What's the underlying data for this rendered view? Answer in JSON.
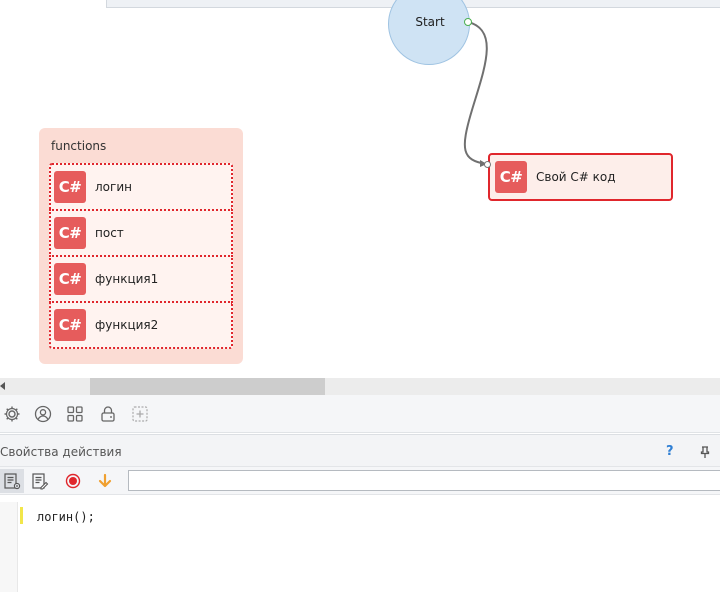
{
  "canvas": {
    "start_node": {
      "label": "Start"
    },
    "action_node": {
      "badge": "C#",
      "label": "Свой C# код"
    },
    "functions_group": {
      "title": "functions",
      "items": [
        {
          "badge": "C#",
          "label": "логин"
        },
        {
          "badge": "C#",
          "label": "пост"
        },
        {
          "badge": "C#",
          "label": "функция1"
        },
        {
          "badge": "C#",
          "label": "функция2"
        }
      ]
    }
  },
  "toolbar": {
    "icons": [
      "settings-icon",
      "user-icon",
      "grid-icon",
      "lock-icon",
      "add-icon"
    ]
  },
  "properties": {
    "title": "Свойства действия",
    "help_label": "?",
    "toolbar_icons": [
      "code-settings-icon",
      "edit-code-icon",
      "record-icon",
      "arrow-down-icon"
    ],
    "input_value": "",
    "code": "логин();"
  },
  "colors": {
    "accent_red": "#e0262c",
    "badge_red": "#e65c5c",
    "start_blue": "#cfe3f4",
    "group_bg": "#fbdcd4",
    "help_blue": "#2f7fd4"
  }
}
